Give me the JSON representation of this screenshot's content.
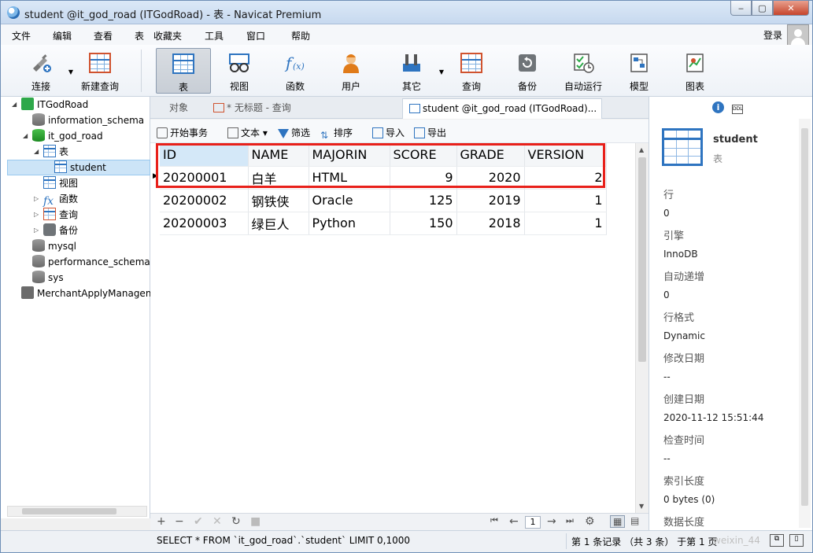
{
  "window": {
    "title": "student @it_god_road (ITGodRoad) - 表 - Navicat Premium",
    "min": "‒",
    "max": "▢",
    "close": "✕"
  },
  "menu": [
    "文件",
    "编辑",
    "查看",
    "表",
    "收藏夹",
    "工具",
    "窗口",
    "帮助"
  ],
  "login": "登录",
  "toolbar": {
    "connect": "连接",
    "new_query": "新建查询",
    "table": "表",
    "view": "视图",
    "function": "函数",
    "user": "用户",
    "other": "其它",
    "query": "查询",
    "backup": "备份",
    "auto_run": "自动运行",
    "model": "模型",
    "chart": "图表"
  },
  "nav": {
    "conn1": "ITGodRoad",
    "db_info": "information_schema",
    "db_main": "it_god_road",
    "grp_table": "表",
    "tbl_student": "student",
    "grp_view": "视图",
    "grp_func": "函数",
    "grp_query": "查询",
    "grp_backup": "备份",
    "db_mysql": "mysql",
    "db_perf": "performance_schema",
    "db_sys": "sys",
    "conn2": "MerchantApplyManagem"
  },
  "tabs": {
    "objects": "对象",
    "untitled": "* 无标题 - 查询",
    "student": "student @it_god_road (ITGodRoad)..."
  },
  "subtoolbar": {
    "begin_tx": "开始事务",
    "text": "文本",
    "filter": "筛选",
    "sort": "排序",
    "import": "导入",
    "export": "导出"
  },
  "grid": {
    "columns": [
      "ID",
      "NAME",
      "MAJORIN",
      "SCORE",
      "GRADE",
      "VERSION"
    ],
    "rows": [
      [
        "20200001",
        "白羊",
        "HTML",
        "9",
        "2020",
        "2"
      ],
      [
        "20200002",
        "钢铁侠",
        "Oracle",
        "125",
        "2019",
        "1"
      ],
      [
        "20200003",
        "绿巨人",
        "Python",
        "150",
        "2018",
        "1"
      ]
    ]
  },
  "gridnav": {
    "page": "1"
  },
  "info": {
    "name": "student",
    "type": "表",
    "props": [
      {
        "k": "行",
        "v": "0"
      },
      {
        "k": "引擎",
        "v": "InnoDB"
      },
      {
        "k": "自动递增",
        "v": "0"
      },
      {
        "k": "行格式",
        "v": "Dynamic"
      },
      {
        "k": "修改日期",
        "v": "--"
      },
      {
        "k": "创建日期",
        "v": "2020-11-12 15:51:44"
      },
      {
        "k": "检查时间",
        "v": "--"
      },
      {
        "k": "索引长度",
        "v": "0 bytes (0)"
      },
      {
        "k": "数据长度",
        "v": ""
      }
    ]
  },
  "status": {
    "sql": "SELECT * FROM `it_god_road`.`student` LIMIT 0,1000",
    "records": "第 1 条记录 （共 3 条） 于第 1 页",
    "watermark": "weixin_44"
  },
  "colors": {
    "highlight_box": "#e8201a",
    "accent": "#2e74c0"
  }
}
